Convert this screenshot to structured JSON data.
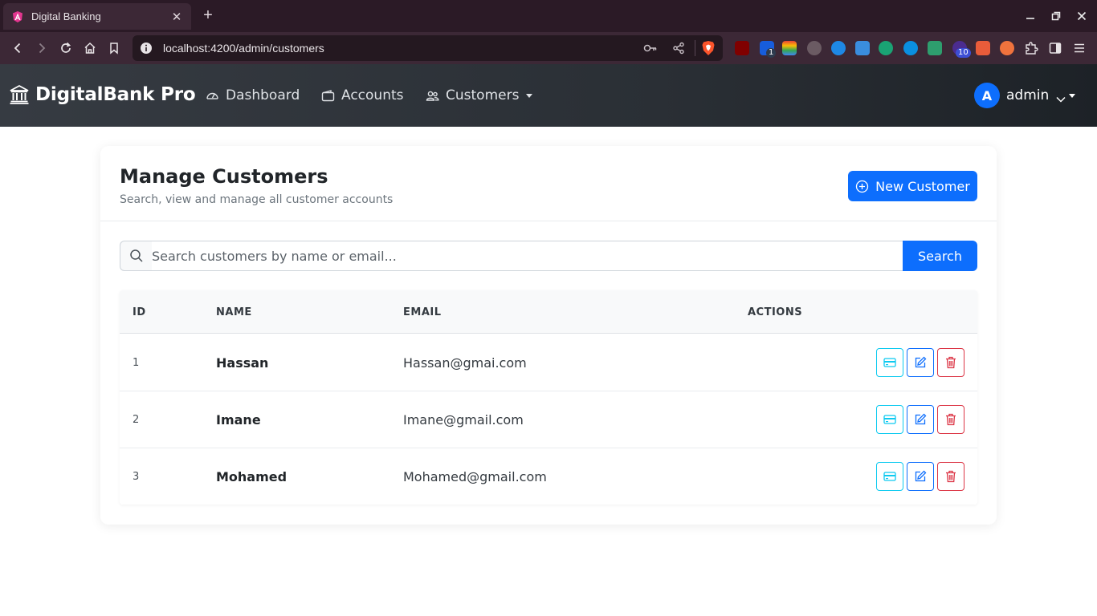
{
  "browser": {
    "tab_title": "Digital Banking",
    "url": "localhost:4200/admin/customers",
    "extension_badges": {
      "bitwarden": "1",
      "hub": "10"
    }
  },
  "navbar": {
    "brand": "DigitalBank Pro",
    "links": [
      {
        "label": "Dashboard",
        "icon": "speedometer-icon"
      },
      {
        "label": "Accounts",
        "icon": "wallet-icon"
      },
      {
        "label": "Customers",
        "icon": "people-icon"
      }
    ],
    "user": {
      "initial": "A",
      "name": "admin"
    }
  },
  "page": {
    "title": "Manage Customers",
    "subtitle": "Search, view and manage all customer accounts",
    "new_button": "New Customer"
  },
  "search": {
    "placeholder": "Search customers by name or email...",
    "button": "Search"
  },
  "table": {
    "headers": [
      "ID",
      "NAME",
      "EMAIL",
      "ACTIONS"
    ],
    "rows": [
      {
        "id": "1",
        "name": "Hassan",
        "email": "Hassan@gmai.com"
      },
      {
        "id": "2",
        "name": "Imane",
        "email": "Imane@gmail.com"
      },
      {
        "id": "3",
        "name": "Mohamed",
        "email": "Mohamed@gmail.com"
      }
    ]
  },
  "colors": {
    "primary": "#0d6efd",
    "info": "#0dcaf0",
    "danger": "#dc3545",
    "navbar_dark": "#2a2f35",
    "browser_frame": "#3c2836"
  }
}
